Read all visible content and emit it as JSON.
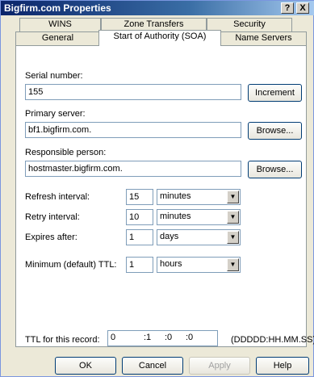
{
  "window": {
    "title": "Bigfirm.com Properties",
    "help_glyph": "?",
    "close_glyph": "X"
  },
  "tabs": {
    "row1": [
      "WINS",
      "Zone Transfers",
      "Security"
    ],
    "row2": [
      "General",
      "Start of Authority (SOA)",
      "Name Servers"
    ],
    "active": "Start of Authority (SOA)"
  },
  "soa": {
    "serial_label": "Serial number:",
    "serial_value": "155",
    "increment_label": "Increment",
    "primary_label": "Primary server:",
    "primary_value": "bf1.bigfirm.com.",
    "browse_label": "Browse...",
    "responsible_label": "Responsible person:",
    "responsible_value": "hostmaster.bigfirm.com.",
    "refresh_label": "Refresh interval:",
    "refresh_value": "15",
    "refresh_unit": "minutes",
    "retry_label": "Retry interval:",
    "retry_value": "10",
    "retry_unit": "minutes",
    "expires_label": "Expires after:",
    "expires_value": "1",
    "expires_unit": "days",
    "min_ttl_label": "Minimum (default) TTL:",
    "min_ttl_value": "1",
    "min_ttl_unit": "hours",
    "record_ttl_label": "TTL for this record:",
    "record_ttl_days": "0",
    "record_ttl_hours": ":1",
    "record_ttl_minutes": ":0",
    "record_ttl_seconds": ":0",
    "record_ttl_format": "(DDDDD:HH.MM.SS)"
  },
  "buttons": {
    "ok": "OK",
    "cancel": "Cancel",
    "apply": "Apply",
    "help": "Help"
  }
}
